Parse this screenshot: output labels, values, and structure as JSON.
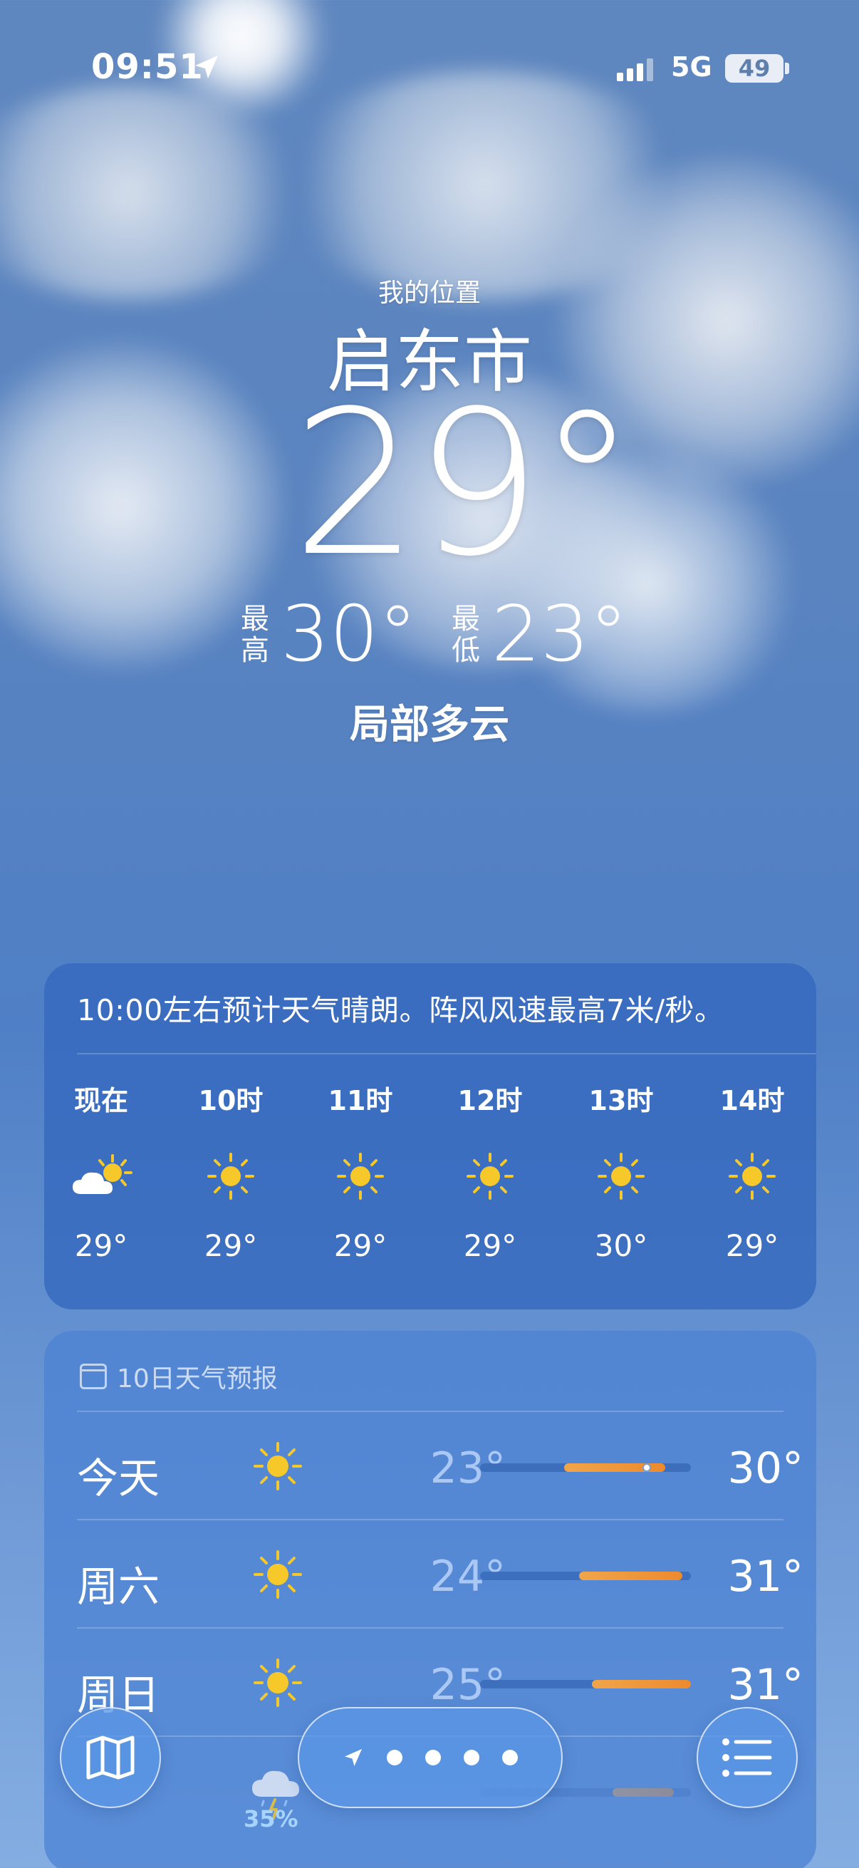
{
  "status_bar": {
    "time": "09:51",
    "network": "5G",
    "battery": "49"
  },
  "hero": {
    "subtitle": "我的位置",
    "city": "启东市",
    "temperature": "29°",
    "high_label": "最高",
    "high": "30°",
    "low_label": "最低",
    "low": "23°",
    "condition": "局部多云"
  },
  "hourly": {
    "summary": "10:00左右预计天气晴朗。阵风风速最高7米/秒。",
    "items": [
      {
        "label": "现在",
        "icon": "partly-cloudy-icon",
        "temp": "29°"
      },
      {
        "label": "10时",
        "icon": "sun-icon",
        "temp": "29°"
      },
      {
        "label": "11时",
        "icon": "sun-icon",
        "temp": "29°"
      },
      {
        "label": "12时",
        "icon": "sun-icon",
        "temp": "29°"
      },
      {
        "label": "13时",
        "icon": "sun-icon",
        "temp": "30°"
      },
      {
        "label": "14时",
        "icon": "sun-icon",
        "temp": "29°"
      }
    ]
  },
  "daily": {
    "title": "10日天气预报",
    "items": [
      {
        "day": "今天",
        "icon": "sun-icon",
        "low": "23°",
        "high": "30°",
        "range_start": 0.4,
        "range_end": 0.88,
        "current": 0.79
      },
      {
        "day": "周六",
        "icon": "sun-icon",
        "low": "24°",
        "high": "31°",
        "range_start": 0.47,
        "range_end": 0.96
      },
      {
        "day": "周日",
        "icon": "sun-icon",
        "low": "25°",
        "high": "31°",
        "range_start": 0.53,
        "range_end": 1.0
      },
      {
        "day": "",
        "icon": "thunderstorm-icon",
        "rain": "35%",
        "low": "",
        "high": "",
        "range_start": 0.63,
        "range_end": 0.92
      }
    ]
  },
  "controls": {
    "map": "map-icon",
    "list": "list-icon",
    "pages": 4
  },
  "colors": {
    "sun": "#f6c829",
    "range_orange": "#ed8a2e",
    "card_blue": "#3468be"
  }
}
